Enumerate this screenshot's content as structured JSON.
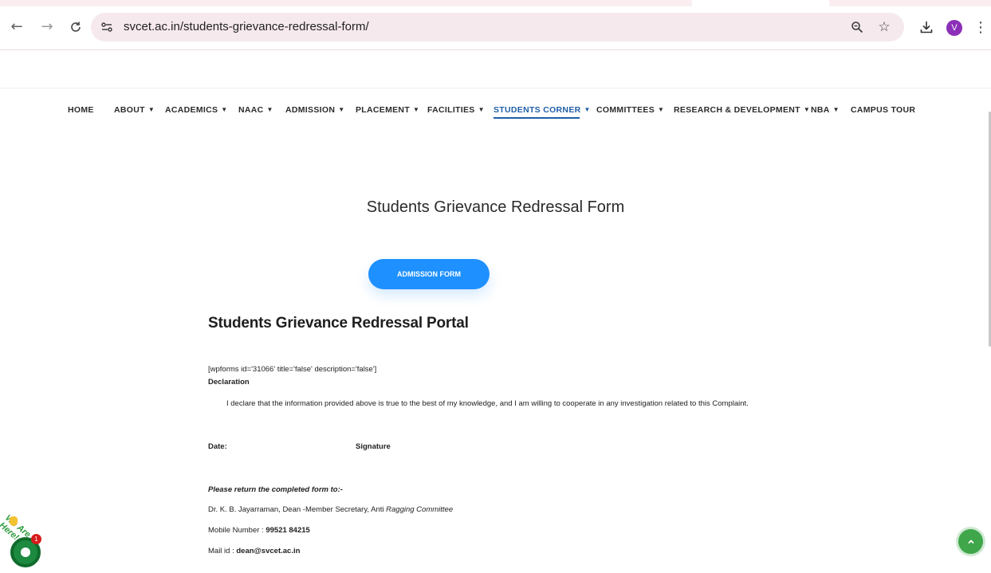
{
  "browser": {
    "back_icon": "←",
    "forward_icon": "→",
    "reload_icon": "C",
    "url": "svcet.ac.in/students-grievance-redressal-form/",
    "zoom_icon": "zoom-icon",
    "bookmark_icon": "star-icon",
    "download_icon": "download-icon",
    "profile_initial": "V",
    "menu_icon": "⋮"
  },
  "nav": {
    "items": [
      {
        "label": "HOME",
        "dropdown": false
      },
      {
        "label": "ABOUT",
        "dropdown": true
      },
      {
        "label": "ACADEMICS",
        "dropdown": true
      },
      {
        "label": "NAAC",
        "dropdown": true
      },
      {
        "label": "ADMISSION",
        "dropdown": true
      },
      {
        "label": "PLACEMENT",
        "dropdown": true
      },
      {
        "label": "FACILITIES",
        "dropdown": true
      },
      {
        "label": "STUDENTS CORNER",
        "dropdown": true
      },
      {
        "label": "COMMITTEES",
        "dropdown": true
      },
      {
        "label": "RESEARCH & DEVELOPMENT",
        "dropdown": true
      },
      {
        "label": "NBA",
        "dropdown": true
      },
      {
        "label": "CAMPUS TOUR",
        "dropdown": false
      }
    ],
    "caret": "▼",
    "active": "STUDENTS CORNER"
  },
  "page": {
    "title": "Students Grievance Redressal Form",
    "admission_button": "ADMISSION FORM",
    "portal_title": "Students Grievance Redressal Portal",
    "shortcode": "[wpforms id='31066' title='false' description='false']",
    "declaration_heading": "Declaration",
    "declaration_text": "I declare that the information provided above is true to the best of my knowledge, and I am willing to cooperate in any investigation related to this Complaint.",
    "date_label": "Date:",
    "signature_label": "Signature",
    "return_heading": "Please return the completed form to:-",
    "contact_name_plain": "Dr. K. B. Jayarraman, Dean -Member Secretary, Anti ",
    "contact_name_italic": "Ragging Committee",
    "mobile_label": "Mobile Number : ",
    "mobile_value": "99521 84215",
    "mail_label": "Mail id : ",
    "mail_value": "dean@svcet.ac.in"
  },
  "widgets": {
    "chat_label": "We Are Here!",
    "chat_count": "1",
    "back_to_top_icon": "^"
  },
  "colors": {
    "accent": "#1e90ff",
    "nav_active": "#1f5fa8",
    "chat_green": "#1c8a3f",
    "back_top_green": "#3fa64a"
  }
}
